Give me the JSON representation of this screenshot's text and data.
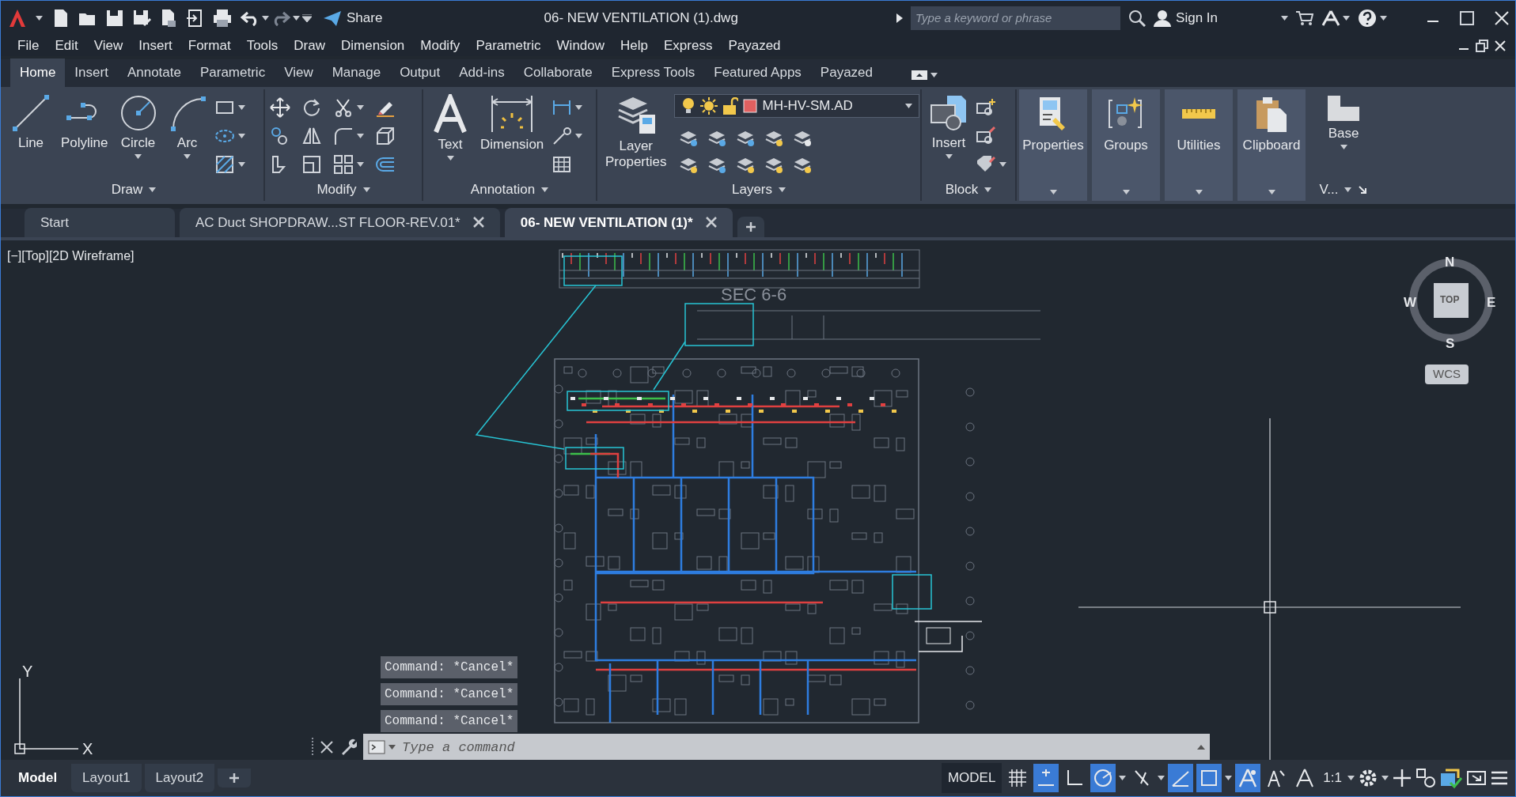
{
  "title_bar": {
    "share": "Share",
    "title": "06- NEW VENTILATION (1).dwg",
    "search": {
      "placeholder": "Type a keyword or phrase"
    },
    "sign_in": "Sign In"
  },
  "menu": [
    "File",
    "Edit",
    "View",
    "Insert",
    "Format",
    "Tools",
    "Draw",
    "Dimension",
    "Modify",
    "Parametric",
    "Window",
    "Help",
    "Express",
    "Payazed"
  ],
  "ribbon_tabs": [
    {
      "label": "Home",
      "selected": true
    },
    {
      "label": "Insert",
      "selected": false
    },
    {
      "label": "Annotate",
      "selected": false
    },
    {
      "label": "Parametric",
      "selected": false
    },
    {
      "label": "View",
      "selected": false
    },
    {
      "label": "Manage",
      "selected": false
    },
    {
      "label": "Output",
      "selected": false
    },
    {
      "label": "Add-ins",
      "selected": false
    },
    {
      "label": "Collaborate",
      "selected": false
    },
    {
      "label": "Express Tools",
      "selected": false
    },
    {
      "label": "Featured Apps",
      "selected": false
    },
    {
      "label": "Payazed",
      "selected": false
    }
  ],
  "ribbon": {
    "draw": {
      "tools": [
        "Line",
        "Polyline",
        "Circle",
        "Arc"
      ],
      "title": "Draw"
    },
    "modify": {
      "title": "Modify"
    },
    "annotation": {
      "tools": [
        "Text",
        "Dimension"
      ],
      "title": "Annotation"
    },
    "layers": {
      "properties": "Layer Properties",
      "current_layer": "MH-HV-SM.AD",
      "title": "Layers"
    },
    "block": {
      "insert": "Insert",
      "title": "Block"
    },
    "panels": [
      "Properties",
      "Groups",
      "Utilities",
      "Clipboard"
    ],
    "view": {
      "base": "Base",
      "title": "V..."
    }
  },
  "doc_tabs": [
    {
      "label": "Start",
      "selected": false,
      "closable": false
    },
    {
      "label": "AC Duct SHOPDRAW...ST FLOOR-REV.01*",
      "selected": false,
      "closable": true
    },
    {
      "label": "06- NEW VENTILATION (1)*",
      "selected": true,
      "closable": true
    }
  ],
  "viewport": {
    "label": "[−][Top][2D Wireframe]",
    "section_label": "SEC 6-6",
    "viewcube": {
      "north": "N",
      "south": "S",
      "east": "E",
      "west": "W",
      "face": "TOP",
      "ucs": "WCS"
    },
    "ucs_icon": {
      "x": "X",
      "y": "Y"
    }
  },
  "command": {
    "history": [
      "Command: *Cancel*",
      "Command: *Cancel*",
      "Command: *Cancel*"
    ],
    "placeholder": "Type a command"
  },
  "layout_tabs": [
    {
      "label": "Model",
      "selected": true
    },
    {
      "label": "Layout1",
      "selected": false
    },
    {
      "label": "Layout2",
      "selected": false
    }
  ],
  "status_bar": {
    "model": "MODEL",
    "scale": "1:1",
    "toggles": [
      {
        "kind": "grid",
        "on": false
      },
      {
        "kind": "snap",
        "on": true
      },
      {
        "kind": "ortho",
        "on": false
      },
      {
        "kind": "polar",
        "on": true
      },
      {
        "kind": "isodraft",
        "on": false
      },
      {
        "kind": "otrack",
        "on": true
      },
      {
        "kind": "osnap",
        "on": true
      },
      {
        "kind": "annovis",
        "on": true
      },
      {
        "kind": "autoscale",
        "on": false
      },
      {
        "kind": "annoscale",
        "on": false
      }
    ]
  }
}
